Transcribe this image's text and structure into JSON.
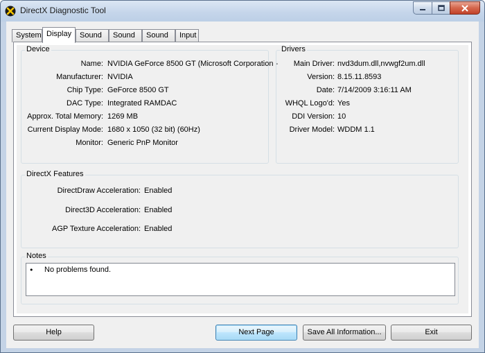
{
  "window": {
    "title": "DirectX Diagnostic Tool"
  },
  "tabs": [
    {
      "label": "System",
      "active": false
    },
    {
      "label": "Display",
      "active": true
    },
    {
      "label": "Sound 1",
      "active": false
    },
    {
      "label": "Sound 2",
      "active": false
    },
    {
      "label": "Sound 3",
      "active": false
    },
    {
      "label": "Input",
      "active": false
    }
  ],
  "device": {
    "title": "Device",
    "rows": [
      {
        "label": "Name:",
        "value": "NVIDIA GeForce 8500 GT (Microsoft Corporation -"
      },
      {
        "label": "Manufacturer:",
        "value": "NVIDIA"
      },
      {
        "label": "Chip Type:",
        "value": "GeForce 8500 GT"
      },
      {
        "label": "DAC Type:",
        "value": "Integrated RAMDAC"
      },
      {
        "label": "Approx. Total Memory:",
        "value": "1269 MB"
      },
      {
        "label": "Current Display Mode:",
        "value": "1680 x 1050 (32 bit) (60Hz)"
      },
      {
        "label": "Monitor:",
        "value": "Generic PnP Monitor"
      }
    ]
  },
  "drivers": {
    "title": "Drivers",
    "rows": [
      {
        "label": "Main Driver:",
        "value": "nvd3dum.dll,nvwgf2um.dll"
      },
      {
        "label": "Version:",
        "value": "8.15.11.8593"
      },
      {
        "label": "Date:",
        "value": "7/14/2009 3:16:11 AM"
      },
      {
        "label": "WHQL Logo'd:",
        "value": "Yes"
      },
      {
        "label": "DDI Version:",
        "value": "10"
      },
      {
        "label": "Driver Model:",
        "value": "WDDM 1.1"
      }
    ]
  },
  "features": {
    "title": "DirectX Features",
    "rows": [
      {
        "label": "DirectDraw Acceleration:",
        "value": "Enabled"
      },
      {
        "label": "Direct3D Acceleration:",
        "value": "Enabled"
      },
      {
        "label": "AGP Texture Acceleration:",
        "value": "Enabled"
      }
    ]
  },
  "notes": {
    "title": "Notes",
    "bullet": "•",
    "items": [
      "No problems found."
    ]
  },
  "buttons": {
    "help": "Help",
    "next_page": "Next Page",
    "save_all": "Save All Information...",
    "exit": "Exit"
  },
  "colors": {
    "title_bar": "#c4d5ea",
    "close_button": "#c2432a",
    "default_button_border": "#3c7fb1"
  }
}
